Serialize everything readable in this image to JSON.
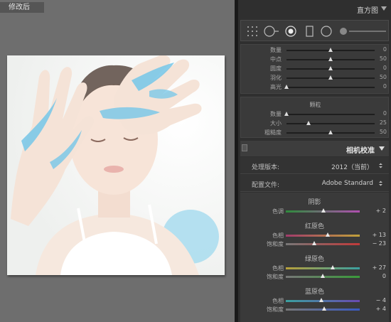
{
  "preview": {
    "view_label": "修改后"
  },
  "panel": {
    "histogram_title": "直方图",
    "vignette_sliders": [
      {
        "label": "数量",
        "value": "0",
        "position": 0.5
      },
      {
        "label": "中点",
        "value": "50",
        "position": 0.5
      },
      {
        "label": "圆度",
        "value": "0",
        "position": 0.5
      },
      {
        "label": "羽化",
        "value": "50",
        "position": 0.5
      },
      {
        "label": "高光",
        "value": "0",
        "position": 0.0
      }
    ],
    "grain": {
      "title": "颗粒",
      "sliders": [
        {
          "label": "数量",
          "value": "0",
          "position": 0.0
        },
        {
          "label": "大小",
          "value": "25",
          "position": 0.25
        },
        {
          "label": "粗糙度",
          "value": "50",
          "position": 0.5
        }
      ]
    },
    "calibration": {
      "title": "相机校准",
      "process_label": "处理版本:",
      "process_value": "2012（当前）",
      "profile_label": "配置文件:",
      "profile_value": "Adobe Standard",
      "shadows": {
        "title": "阴影",
        "sliders": [
          {
            "label": "色调",
            "value": "+ 2",
            "position": 0.51,
            "gradient": [
              "#2e8b3c",
              "#b04fb0"
            ]
          }
        ]
      },
      "red_primary": {
        "title": "红原色",
        "sliders": [
          {
            "label": "色相",
            "value": "+ 13",
            "position": 0.565,
            "gradient": [
              "#a23b6b",
              "#c0a03a"
            ]
          },
          {
            "label": "饱和度",
            "value": "− 23",
            "position": 0.385,
            "gradient": [
              "#777777",
              "#c03a3a"
            ]
          }
        ]
      },
      "green_primary": {
        "title": "绿原色",
        "sliders": [
          {
            "label": "色相",
            "value": "+ 27",
            "position": 0.635,
            "gradient": [
              "#b8a03a",
              "#3aa0a0"
            ]
          },
          {
            "label": "饱和度",
            "value": "0",
            "position": 0.5,
            "gradient": [
              "#777777",
              "#3a9a3a"
            ]
          }
        ]
      },
      "blue_primary": {
        "title": "蓝原色",
        "sliders": [
          {
            "label": "色相",
            "value": "− 4",
            "position": 0.48,
            "gradient": [
              "#3aa0a0",
              "#6a4ab0"
            ]
          },
          {
            "label": "饱和度",
            "value": "+ 4",
            "position": 0.52,
            "gradient": [
              "#777777",
              "#3a5ac0"
            ]
          }
        ]
      }
    }
  },
  "colors": {
    "panel_bg": "#2f2f2f",
    "preview_bg": "#6e6e6e",
    "accent_paint": "#7cc8e8"
  }
}
